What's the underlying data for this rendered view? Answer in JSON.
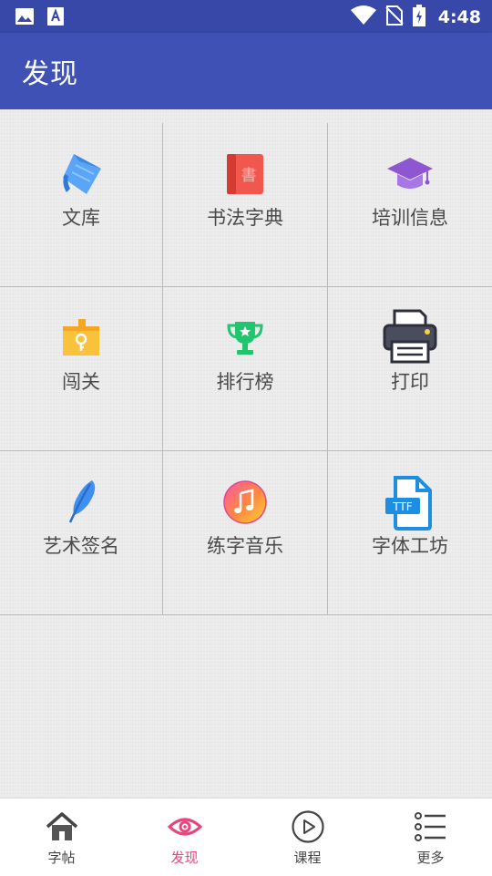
{
  "status_bar": {
    "time": "4:48",
    "icons": [
      "image-icon",
      "text-a-icon",
      "wifi-icon",
      "no-sim-icon",
      "battery-charging-icon"
    ]
  },
  "app_bar": {
    "title": "发现"
  },
  "grid": {
    "items": [
      {
        "label": "文库",
        "icon": "library-book-icon"
      },
      {
        "label": "书法字典",
        "icon": "calligraphy-dictionary-icon"
      },
      {
        "label": "培训信息",
        "icon": "graduation-cap-icon"
      },
      {
        "label": "闯关",
        "icon": "castle-key-icon"
      },
      {
        "label": "排行榜",
        "icon": "trophy-icon"
      },
      {
        "label": "打印",
        "icon": "printer-icon"
      },
      {
        "label": "艺术签名",
        "icon": "feather-pen-icon"
      },
      {
        "label": "练字音乐",
        "icon": "music-note-icon"
      },
      {
        "label": "字体工坊",
        "icon": "ttf-file-icon"
      }
    ]
  },
  "bottom_nav": {
    "items": [
      {
        "label": "字帖",
        "icon": "home-icon",
        "active": false
      },
      {
        "label": "发现",
        "icon": "eye-icon",
        "active": true
      },
      {
        "label": "课程",
        "icon": "play-circle-icon",
        "active": false
      },
      {
        "label": "更多",
        "icon": "list-icon",
        "active": false
      }
    ]
  },
  "colors": {
    "status_bar": "#3848a8",
    "app_bar": "#3f51b5",
    "active_tab": "#e8457c",
    "inactive_tab": "#444444",
    "grid_label": "#4a4a4a"
  }
}
